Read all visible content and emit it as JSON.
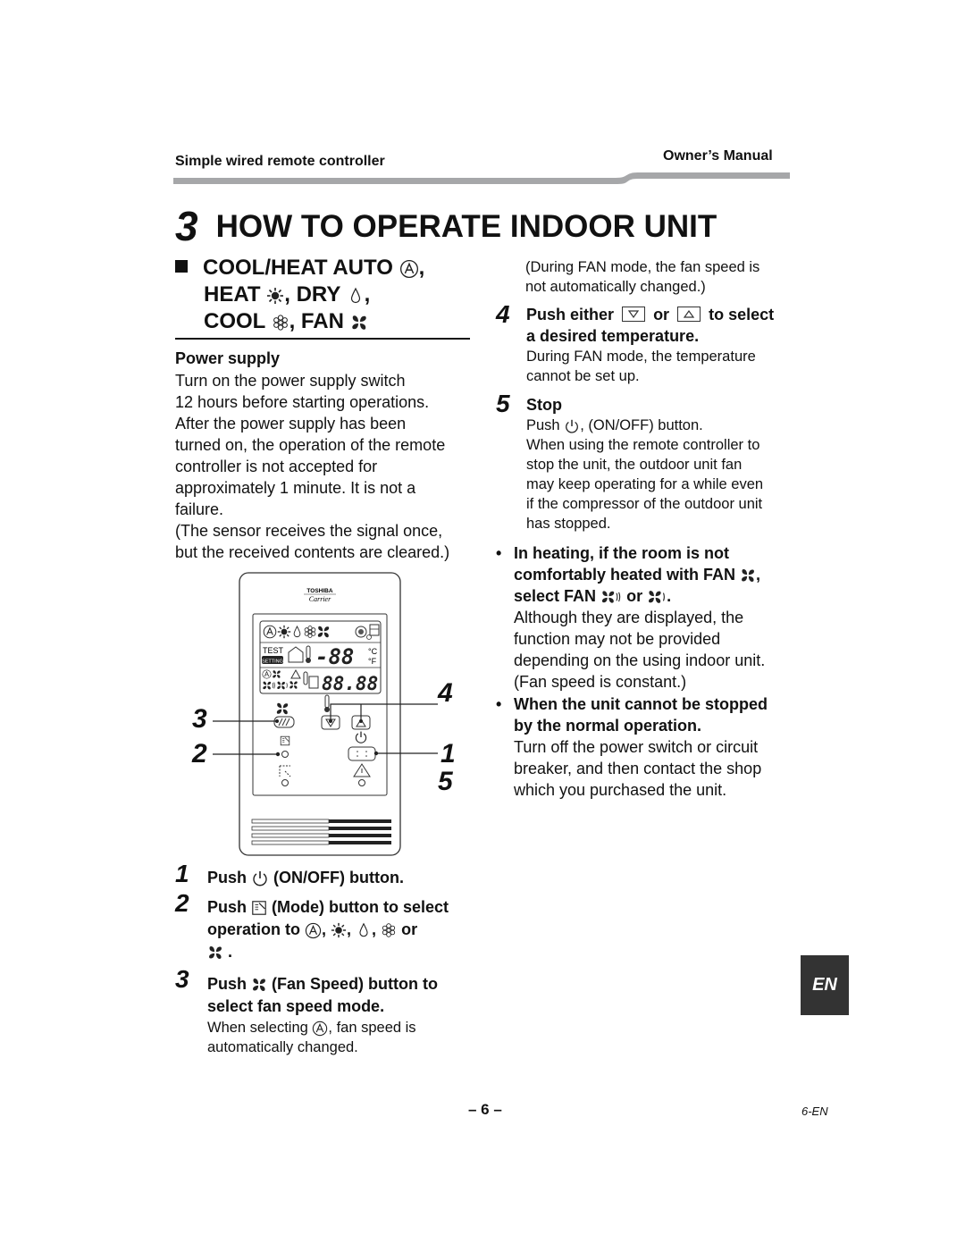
{
  "header": {
    "left": "Simple wired remote controller",
    "right": "Owner’s Manual",
    "bar_color": "#a6a7a9"
  },
  "title": {
    "number": "3",
    "text": "HOW TO OPERATE INDOOR UNIT"
  },
  "section": {
    "line1": "COOL/HEAT AUTO",
    "line2a": "HEAT",
    "line2b": ", DRY",
    "line3a": "COOL",
    "line3b": ", FAN",
    "icons": [
      "auto-mode-icon",
      "heat-sun-icon",
      "dry-drop-icon",
      "cool-snowflake-icon",
      "fan-icon"
    ]
  },
  "power_supply": {
    "title": "Power supply",
    "lines": [
      "Turn on the power supply switch",
      "12 hours before starting operations.",
      "After the power supply has been",
      "turned on, the operation of the remote",
      "controller is not accepted for",
      "approximately 1 minute. It is not a",
      "failure.",
      "(The sensor receives the signal once,",
      "but the received contents are cleared.)"
    ]
  },
  "remote": {
    "brand": "TOSHIBA",
    "sub_brand": "Carrier",
    "lcd": {
      "test": "TEST",
      "setting": "SETTING",
      "temp": "-88",
      "unit_c": "°C",
      "unit_f": "°F",
      "time": "88.88"
    },
    "callouts": [
      "3",
      "2",
      "4",
      "1",
      "5"
    ]
  },
  "steps_left": [
    {
      "num": "1",
      "pre": "Push",
      "post": "(ON/OFF) button."
    },
    {
      "num": "2",
      "pre": "Push",
      "post": "(Mode) button to select",
      "line2": "operation to",
      "or": "or"
    },
    {
      "num": "3",
      "pre": "Push",
      "post": "(Fan Speed) button to",
      "line2": "select fan speed mode.",
      "sub1_pre": "When selecting",
      "sub1_post": ", fan speed is",
      "sub2": "automatically changed."
    }
  ],
  "right": {
    "cont_lines": [
      "(During FAN mode, the fan speed is",
      "not automatically changed.)"
    ],
    "step4": {
      "num": "4",
      "pre": "Push either",
      "mid": "or",
      "post": "to select",
      "line2": "a desired temperature.",
      "sub": [
        "During FAN mode, the temperature",
        "cannot be set up."
      ]
    },
    "step5": {
      "num": "5",
      "title": "Stop",
      "push_pre": "Push",
      "push_post": ", (ON/OFF) button.",
      "sub": [
        "When using the remote controller to",
        "stop the unit, the outdoor unit fan",
        "may keep operating for a while even",
        "if the compressor of the outdoor unit",
        "has stopped."
      ]
    },
    "bullet1": {
      "line1": "In heating, if the room is not",
      "line2": "comfortably heated with FAN",
      "line3_pre": "select FAN",
      "line3_mid": "or",
      "body": [
        "Although they are displayed, the",
        "function may not be provided",
        "depending on the using indoor unit.",
        "(Fan speed is constant.)"
      ]
    },
    "bullet2": {
      "line1": "When the unit cannot be stopped",
      "line2": "by the normal operation.",
      "body": [
        "Turn off the power switch or circuit",
        "breaker, and then contact the shop",
        "which you purchased the unit."
      ]
    }
  },
  "lang_tab": {
    "label": "EN",
    "color": "#333333"
  },
  "footer": {
    "page": "– 6 –",
    "code": "6-EN"
  }
}
